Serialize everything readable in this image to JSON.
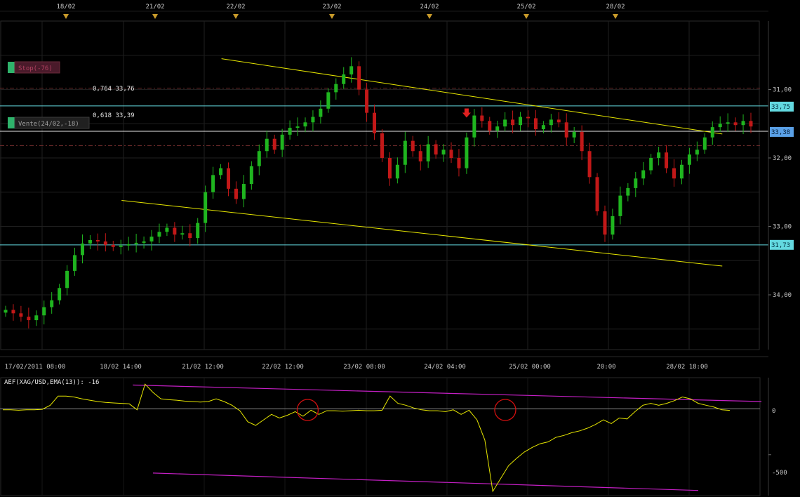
{
  "colors": {
    "background": "#000000",
    "grid": "#1f1f1f",
    "bull_candle": "#1fb51f",
    "bear_candle": "#c21818",
    "trendline": "#e6e600",
    "cyan_level": "#63d9e0",
    "white_level": "#e6e6e6",
    "indicator_line": "#e6e600",
    "channel_magenta": "#c41fc4",
    "circle_marker": "#d41010",
    "sell_arrow": "#e02020",
    "stop_badge_bg": "#4a1a2a",
    "stop_badge_text": "#b04060",
    "vente_badge_bg": "#202020",
    "vente_badge_text": "#a0a0a0",
    "badge_flag": "#2fb36b",
    "axis_text": "#c8c8c8"
  },
  "top_axis": {
    "labels": [
      "18/02",
      "21/02",
      "22/02",
      "23/02",
      "24/02",
      "25/02",
      "28/02"
    ]
  },
  "bottom_axis": {
    "labels": [
      "17/02/2011 08:00",
      "18/02 14:00",
      "21/02 12:00",
      "22/02 12:00",
      "23/02 08:00",
      "24/02 04:00",
      "25/02 00:00",
      "20:00",
      "28/02 18:00"
    ]
  },
  "price_axis": {
    "tick_labels": [
      "34,00",
      "33,00",
      "32,00",
      "31,00"
    ],
    "highlighted": [
      {
        "name": "upper-cyan-tag",
        "label": "33,75",
        "value": 33.75,
        "bg": "#63d9e0",
        "fg": "#003040"
      },
      {
        "name": "white-tag",
        "label": "33,38",
        "value": 33.38,
        "bg": "#5aa0e6",
        "fg": "#001a33"
      },
      {
        "name": "lower-cyan-tag",
        "label": "31,73",
        "value": 31.73,
        "bg": "#63d9e0",
        "fg": "#003040"
      }
    ]
  },
  "badges": {
    "stop": "Stop(-76)",
    "vente": "Vente(24/02,-18)"
  },
  "fib_labels": {
    "level_764": "0,764 33,76",
    "level_618": "0,618 33,39"
  },
  "indicator": {
    "title": "AEF(XAG/USD,EMA(13)): -16",
    "zero_label": "0",
    "minus_label": "-500"
  },
  "chart_data": {
    "type": "candlestick",
    "symbol": "XAG/USD",
    "ylim": [
      30.2,
      35.0
    ],
    "yticks": [
      31.0,
      32.0,
      33.0,
      34.0
    ],
    "horizontal_levels": [
      {
        "name": "fib-0764",
        "value": 33.76,
        "style": "cyan"
      },
      {
        "name": "fib-0618",
        "value": 33.39,
        "style": "white"
      },
      {
        "name": "support-cyan",
        "value": 31.73,
        "style": "cyan"
      },
      {
        "name": "stop-dash",
        "value": 34.02,
        "style": "dash-dot"
      },
      {
        "name": "vente-dash",
        "value": 33.18,
        "style": "dash-dot"
      }
    ],
    "trendlines": [
      {
        "name": "upper-trendline",
        "from": [
          27,
          34.45
        ],
        "to": [
          92,
          33.35
        ]
      },
      {
        "name": "lower-trendline",
        "from": [
          14,
          32.38
        ],
        "to": [
          92,
          31.42
        ]
      }
    ],
    "sell_signal": {
      "index": 60,
      "price": 33.62
    },
    "closes": [
      30.78,
      30.73,
      30.68,
      30.63,
      30.7,
      30.82,
      30.92,
      31.1,
      31.35,
      31.58,
      31.75,
      31.8,
      31.78,
      31.73,
      31.7,
      31.72,
      31.74,
      31.76,
      31.78,
      31.85,
      31.92,
      31.98,
      31.88,
      31.9,
      31.83,
      32.05,
      32.5,
      32.75,
      32.85,
      32.55,
      32.4,
      32.62,
      32.88,
      33.1,
      33.28,
      33.12,
      33.34,
      33.44,
      33.46,
      33.52,
      33.6,
      33.72,
      33.96,
      34.08,
      34.22,
      34.34,
      34.0,
      33.66,
      33.36,
      33.0,
      32.7,
      32.9,
      33.25,
      33.1,
      32.95,
      33.2,
      33.05,
      33.12,
      33.0,
      32.85,
      33.3,
      33.62,
      33.54,
      33.4,
      33.46,
      33.56,
      33.48,
      33.6,
      33.58,
      33.42,
      33.48,
      33.56,
      33.52,
      33.3,
      33.38,
      33.1,
      32.72,
      32.22,
      31.88,
      32.15,
      32.45,
      32.56,
      32.7,
      32.82,
      33.0,
      33.08,
      32.85,
      32.7,
      32.9,
      33.05,
      33.12,
      33.3,
      33.45,
      33.5,
      33.52,
      33.48,
      33.54,
      33.46
    ],
    "indicator_series": [
      -10,
      -10,
      -15,
      -10,
      -10,
      -5,
      40,
      140,
      140,
      130,
      110,
      95,
      80,
      70,
      65,
      60,
      55,
      -10,
      270,
      180,
      110,
      100,
      95,
      85,
      80,
      75,
      80,
      110,
      80,
      40,
      -20,
      -140,
      -180,
      -120,
      -60,
      -100,
      -70,
      -30,
      -80,
      -15,
      -60,
      -20,
      -20,
      -25,
      -20,
      -15,
      -20,
      -20,
      -15,
      140,
      60,
      40,
      10,
      -10,
      -20,
      -20,
      -30,
      -10,
      -60,
      -15,
      -120,
      -340,
      -900,
      -760,
      -620,
      -540,
      -470,
      -420,
      -380,
      -360,
      -310,
      -290,
      -260,
      -240,
      -210,
      -170,
      -120,
      -160,
      -100,
      -110,
      -30,
      40,
      60,
      40,
      60,
      90,
      130,
      110,
      60,
      40,
      20,
      -10,
      -16
    ],
    "indicator_ylim": [
      -900,
      310
    ],
    "indicator_channel": {
      "upper": {
        "from": [
          28,
          260
        ],
        "to": [
          96,
          80
        ]
      },
      "lower": {
        "from": [
          19,
          -700
        ],
        "to": [
          96,
          -890
        ]
      }
    },
    "indicator_circles": [
      {
        "index": 40,
        "value": -50
      },
      {
        "index": 65,
        "value": -50
      }
    ]
  }
}
